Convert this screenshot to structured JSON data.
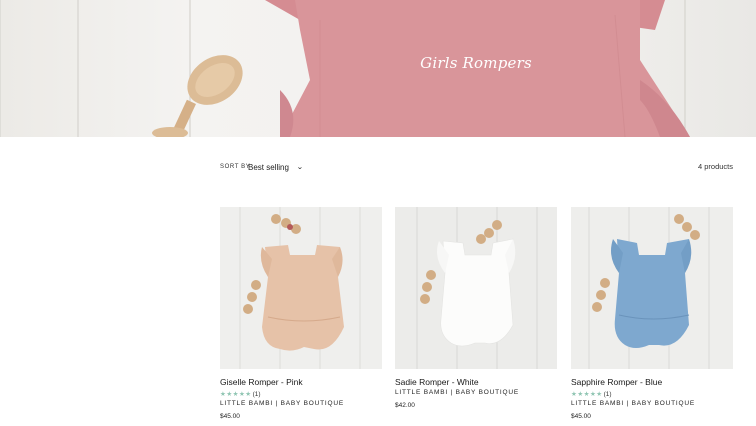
{
  "hero": {
    "title": "Girls Rompers"
  },
  "toolbar": {
    "sort_label": "SORT BY",
    "sort_value": "Best selling",
    "product_count": "4 products"
  },
  "products": [
    {
      "name": "Giselle Romper - Pink",
      "stars": "★★★★★",
      "rating_count": "(1)",
      "vendor": "LITTLE BAMBI | BABY BOUTIQUE",
      "price": "$45.00",
      "color": "#e8c4ac"
    },
    {
      "name": "Sadie Romper - White",
      "vendor": "LITTLE BAMBI | BABY BOUTIQUE",
      "price": "$42.00",
      "color": "#fbfbfa"
    },
    {
      "name": "Sapphire Romper - Blue",
      "stars": "★★★★★",
      "rating_count": "(1)",
      "vendor": "LITTLE BAMBI | BABY BOUTIQUE",
      "price": "$45.00",
      "color": "#7da6cc"
    }
  ],
  "colors": {
    "star": "#8fc5b2",
    "hero_fabric": "#d99498",
    "wood": "#d8b58f"
  }
}
